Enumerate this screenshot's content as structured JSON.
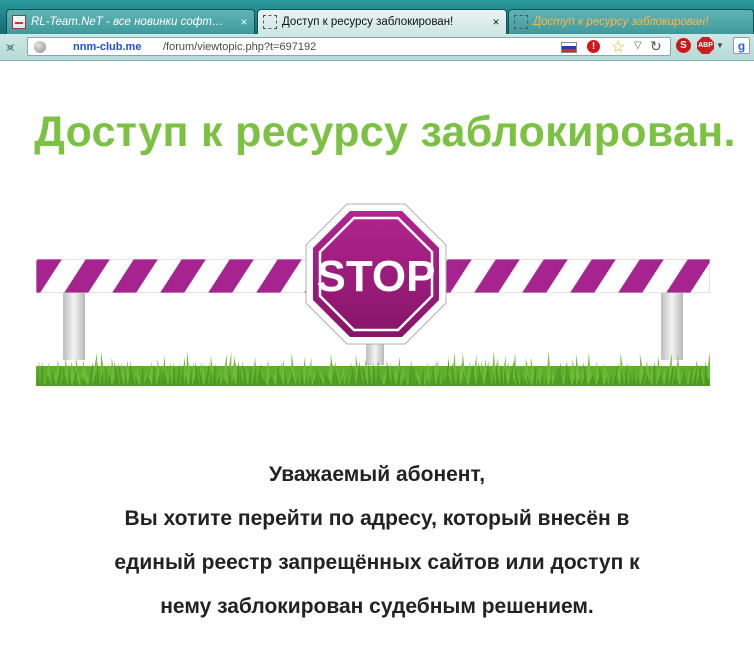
{
  "browser": {
    "tabs": [
      {
        "title": "RL-Team.NeT - все новинки софт…",
        "active": false,
        "favicon": "rl-team-favicon"
      },
      {
        "title": "Доступ к ресурсу заблокирован!",
        "active": true,
        "favicon": "blank-page-icon"
      },
      {
        "title": "Доступ к ресурсу заблокирован!",
        "active": false,
        "favicon": "blank-page-icon"
      }
    ],
    "close_glyph": "×",
    "address": {
      "domain": "nnm-club.me",
      "path": "/forum/viewtopic.php?t=697192"
    },
    "extensions": {
      "abp_label": "ABP",
      "google_label": "g",
      "warning_label": "!",
      "stop_label": "S"
    }
  },
  "page": {
    "heading": "Доступ к ресурсу заблокирован.",
    "stop_sign_text": "STOP",
    "message_lines": [
      "Уважаемый абонент,",
      "Вы хотите перейти по адресу, который внесён в",
      "единый реестр запрещённых сайтов или доступ к",
      "нему заблокирован судебным решением."
    ]
  },
  "colors": {
    "heading": "#7cc242",
    "stop_sign": "#9b1b7e",
    "barrier_stripe": "#a7238f",
    "grass": "#5fae2e"
  }
}
